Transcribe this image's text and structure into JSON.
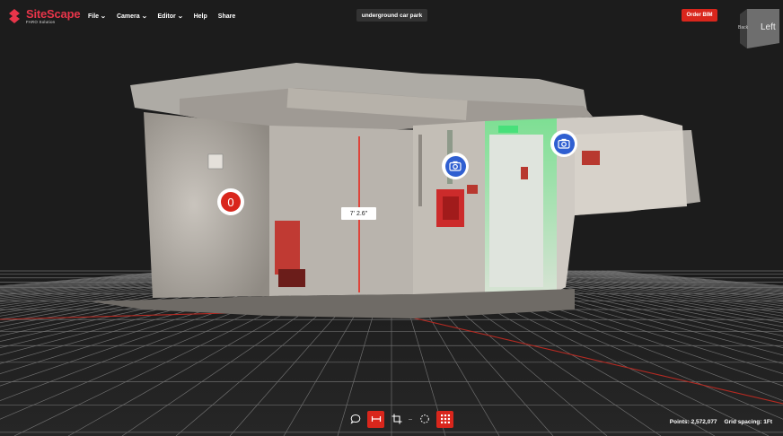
{
  "app": {
    "logo_name": "SiteScape",
    "logo_sub": "FARO Solution"
  },
  "menu": [
    {
      "label": "File",
      "has_dropdown": true
    },
    {
      "label": "Camera",
      "has_dropdown": true
    },
    {
      "label": "Editor",
      "has_dropdown": true
    },
    {
      "label": "Help",
      "has_dropdown": false
    },
    {
      "label": "Share",
      "has_dropdown": false
    }
  ],
  "project": {
    "title": "underground car park"
  },
  "actions": {
    "order_label": "Order BIM"
  },
  "view_cube": {
    "face_label": "Left",
    "side_label": "Back"
  },
  "scene": {
    "measurement_label": "7' 2.6\"",
    "marker_badge": "0",
    "camera_markers": [
      "camera-icon",
      "camera-icon"
    ]
  },
  "toolbar": {
    "tools": [
      "comment-icon",
      "measure-icon",
      "crop-icon",
      "select-icon",
      "grid-icon"
    ]
  },
  "status": {
    "points_label": "Points: 2,572,077",
    "grid_spacing_label": "Grid spacing: 1Ft"
  },
  "colors": {
    "accent": "#d9261c",
    "brand": "#e8354a",
    "camera_marker": "#2f5fd1",
    "background": "#1c1c1c"
  }
}
